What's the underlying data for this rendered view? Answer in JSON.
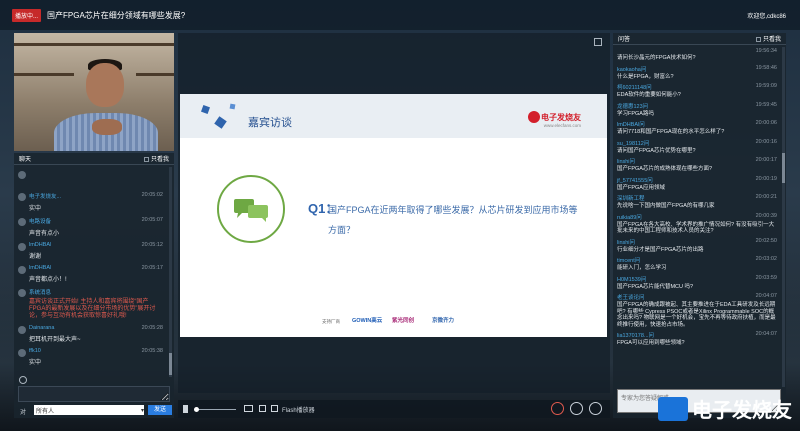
{
  "header": {
    "live_badge": "播放中...",
    "title": "国产FPGA芯片在细分领域有哪些发展?",
    "welcome": "欢迎您,cdkc86"
  },
  "chat": {
    "title": "聊天",
    "only_mine": "只看我",
    "messages": [
      {
        "name": "",
        "time": "",
        "text": ""
      },
      {
        "name": "电子发烧友...",
        "time": "20:05:02",
        "text": "实中"
      },
      {
        "name": "电路设备",
        "time": "20:05:07",
        "text": "声音有点小"
      },
      {
        "name": "lmDHBAl",
        "time": "20:05:12",
        "text": "谢谢"
      },
      {
        "name": "lmDHBAl",
        "time": "20:05:17",
        "text": "声音都点小！!"
      },
      {
        "name": "系统消息",
        "time": "",
        "text": "嘉宾访谈正式开始! 主持人和嘉宾将围绕“国产FPGA的最新发展以及在细分市场的优势”展开讨论，参与互动有机会获取惊喜好礼哦!",
        "system": true
      },
      {
        "name": "Dainarana",
        "time": "20:05:28",
        "text": "把耳机开到最大声~"
      },
      {
        "name": "ffk10",
        "time": "20:05:38",
        "text": "实中"
      }
    ],
    "input_placeholder": "",
    "to_label": "对",
    "to_value": "所有人",
    "send_label": "发送"
  },
  "slide": {
    "title": "嘉宾访谈",
    "brand": "电子发烧友",
    "brand_url": "www.elecfans.com",
    "q_label": "Q1：",
    "q_text": "国产FPGA在近两年取得了哪些发展？从芯片研发到应用市场等方面？",
    "sponsor_label": "支持厂商",
    "sponsors": [
      "GOWIN高云",
      "紫光同创",
      "京微齐力"
    ]
  },
  "controls": {
    "flash_label": "Flash播放器"
  },
  "questions": {
    "title": "问答",
    "only_mine": "只看我",
    "items": [
      {
        "name": "",
        "time": "19:56:34",
        "text": "请问长沙晶元的FPGA技术如何?"
      },
      {
        "name": "kaokaoha问",
        "time": "19:58:46",
        "text": "什么是FPGA，财富么?"
      },
      {
        "name": "柯60211148问",
        "time": "19:59:09",
        "text": "EDA软件的重要如何能小?"
      },
      {
        "name": "龙德惠123问",
        "time": "19:59:45",
        "text": "学习FPGA路吗"
      },
      {
        "name": "lmDHBAl问",
        "time": "20:00:06",
        "text": "请问7718和国产FPGA现在的水平怎么样了?"
      },
      {
        "name": "su_198112问",
        "time": "20:00:16",
        "text": "请问国产FPGA芯片优势在哪里?"
      },
      {
        "name": "linshi问",
        "time": "20:00:17",
        "text": "国产FPGA芯片的成熟体现在哪些方面?"
      },
      {
        "name": "jf_57741555问",
        "time": "20:00:19",
        "text": "国产FPGA应用领域"
      },
      {
        "name": "深圳新工程",
        "time": "20:00:21",
        "text": "先说啥一下国内做国产FPGA的有哪几家"
      },
      {
        "name": "ruikia89问",
        "time": "20:00:39",
        "text": "国产FPGA在各大高校、学术界的推广情况如何? 有没有吸引一大批未来的中国工程师和技术人员的关注?"
      },
      {
        "name": "linshi问",
        "time": "20:02:50",
        "text": "行业细分才是国产FPGA芯片的出路"
      },
      {
        "name": "timcent问",
        "time": "20:03:02",
        "text": "能研入门，怎么学习"
      },
      {
        "name": "H0M1539问",
        "time": "20:03:59",
        "text": "国产FPGA芯片能代替MCU 吗?"
      },
      {
        "name": "老王谈论问",
        "time": "20:04:07",
        "text": "国产FPGA的确成跟被起、其主要推进在于EDA工具研发及长远期吧? 有哪些 Cypress PSOC或者是Xilinx Programmable SOC的概念出来吗? 物联网是一个好机会，宝先不再等待政府扶植，而是最终推行使用，快速抢占市场。"
      },
      {
        "name": "lia1370178...问",
        "time": "20:04:07",
        "text": "FPGA可以应用到哪些领域?"
      }
    ],
    "input_placeholder": "专家为您答疑解惑"
  },
  "watermark": {
    "text": "电子发烧友"
  }
}
